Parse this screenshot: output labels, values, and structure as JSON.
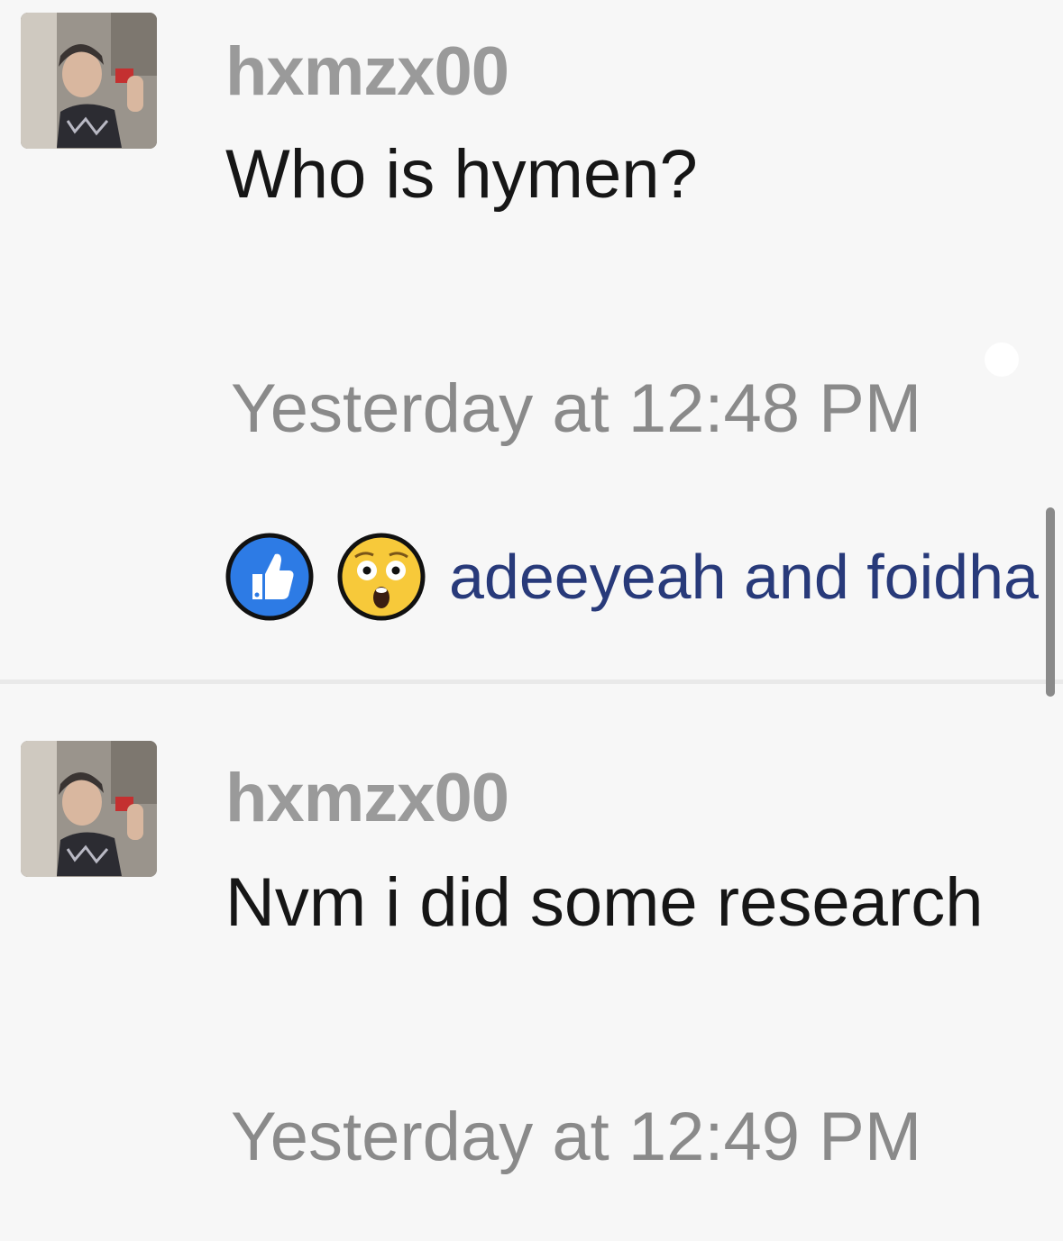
{
  "posts": [
    {
      "username": "hxmzx00",
      "message": "Who is hymen?",
      "timestamp": "Yesterday at 12:48 PM",
      "reactions": {
        "icons": [
          "like-icon",
          "astonished-face-icon"
        ],
        "names": "adeeyeah and foidha"
      }
    },
    {
      "username": "hxmzx00",
      "message": "Nvm i did some research",
      "timestamp": "Yesterday at 12:49 PM"
    }
  ],
  "colors": {
    "background": "#f7f7f7",
    "username": "#9a9a9a",
    "message": "#161616",
    "timestamp": "#8a8a8a",
    "reaction_names": "#283a7a",
    "like_blue": "#2d7be5",
    "emoji_yellow": "#f7c93a"
  }
}
